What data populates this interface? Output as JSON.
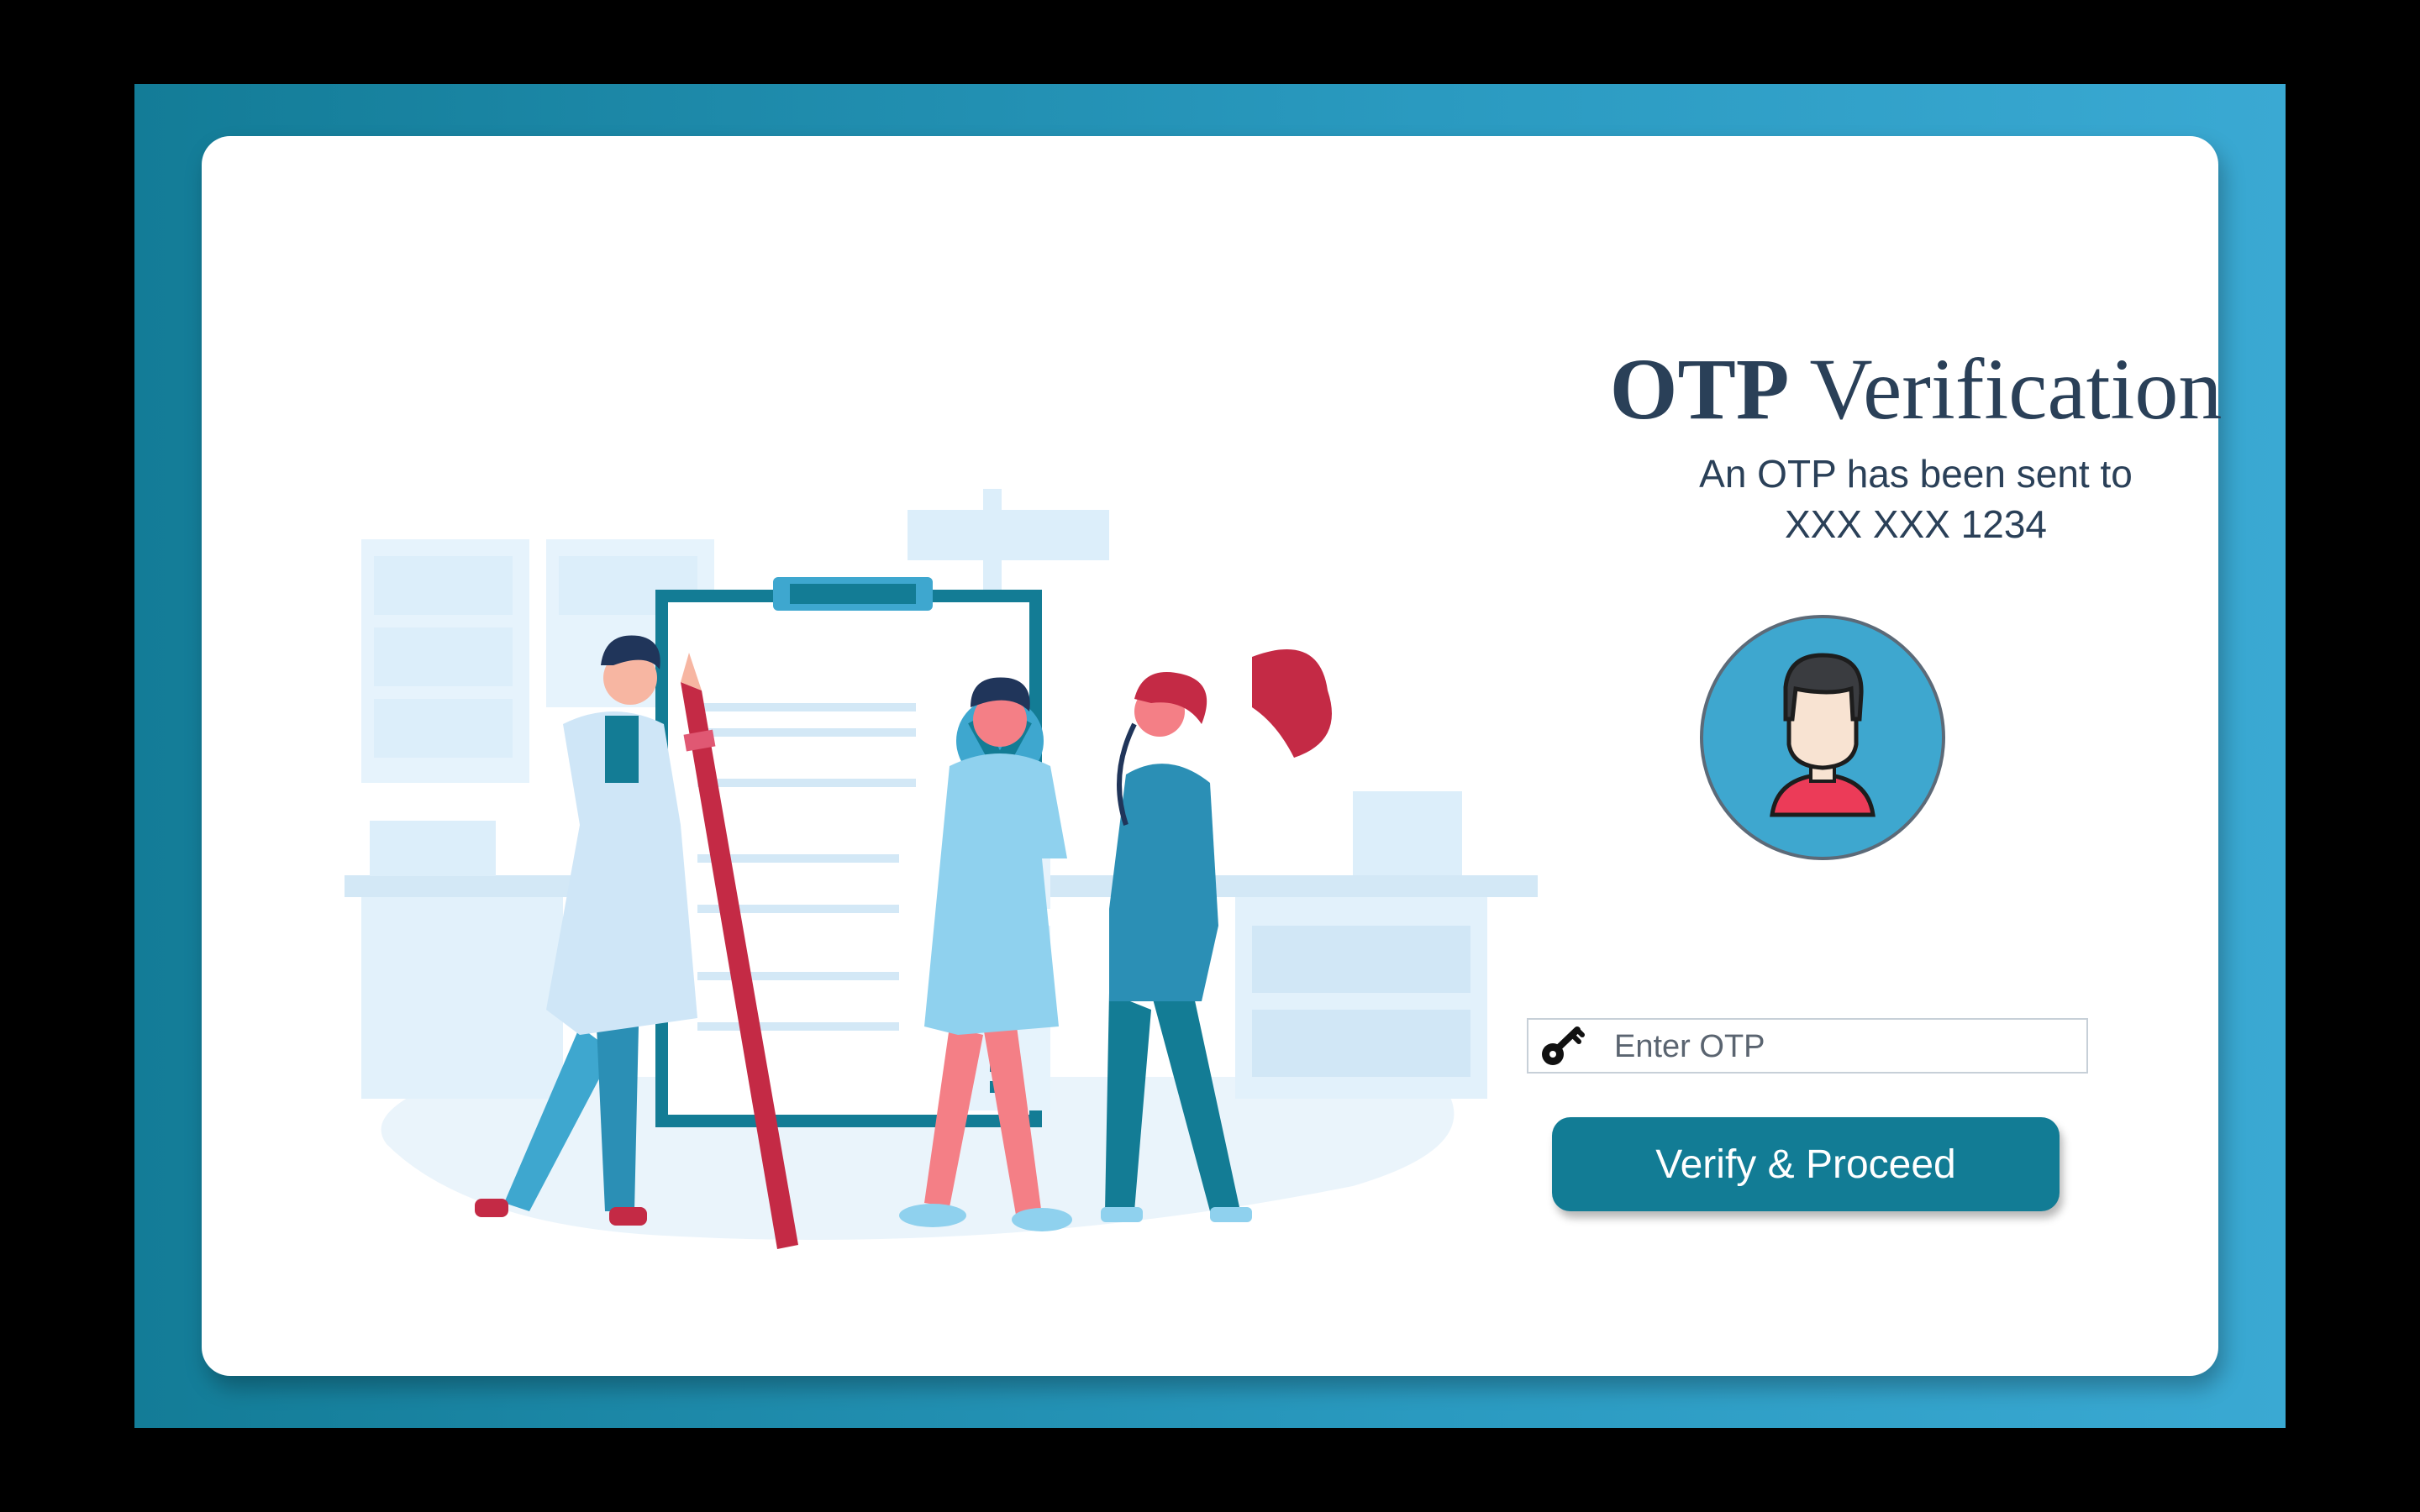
{
  "title": {
    "bold": "OTP",
    "rest": " Verification"
  },
  "subtitle": {
    "line1": "An OTP has been sent to",
    "line2": "XXX XXX 1234"
  },
  "otp_input": {
    "placeholder": "Enter OTP",
    "icon": "key-icon"
  },
  "verify_button": {
    "label": "Verify & Proceed"
  },
  "avatar": {
    "icon": "user-avatar-icon"
  },
  "colors": {
    "frame_gradient_start": "#137c97",
    "frame_gradient_end": "#3aa9d3",
    "title": "#2a4058",
    "button": "#127c95",
    "avatar_bg": "#3ea7cf",
    "accent_red": "#c42a45"
  }
}
